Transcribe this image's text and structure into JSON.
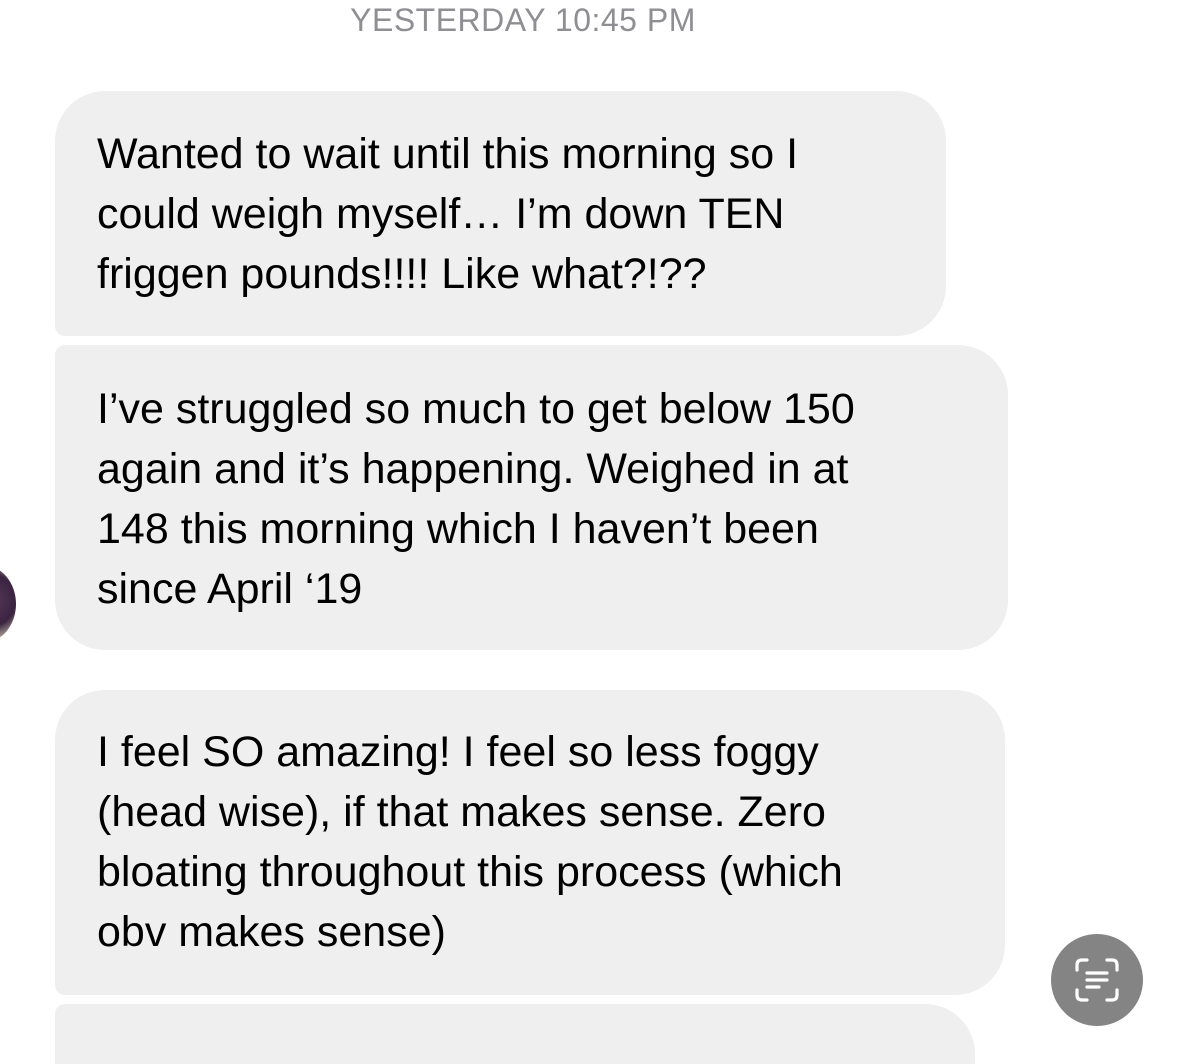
{
  "conversation": {
    "timestamp": "YESTERDAY 10:45 PM",
    "messages": [
      {
        "lines": [
          "Wanted to wait until this morning so I",
          "could weigh myself… I’m down TEN",
          "friggen pounds!!!! Like what?!??"
        ]
      },
      {
        "lines": [
          "I’ve struggled so much to get below 150",
          "again and it’s happening. Weighed in at",
          "148 this morning which I haven’t been",
          "since April ‘19"
        ]
      },
      {
        "lines": [
          "I feel SO amazing! I feel so less foggy",
          "(head wise), if that makes sense. Zero",
          "bloating throughout this process (which",
          "obv makes sense)"
        ]
      }
    ]
  },
  "icons": {
    "live_text": "live-text-icon",
    "avatar": "avatar"
  },
  "colors": {
    "bubble": "#efefef",
    "timestamp": "#8e8e93",
    "live_text_button": "#6e6e6e"
  }
}
